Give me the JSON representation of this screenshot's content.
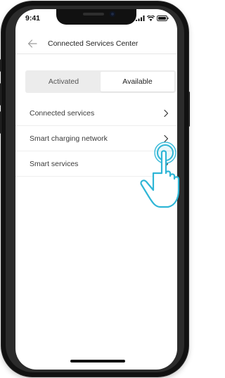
{
  "status_bar": {
    "time": "9:41"
  },
  "header": {
    "title": "Connected Services Center"
  },
  "tabs": [
    {
      "label": "Activated",
      "selected": false
    },
    {
      "label": "Available",
      "selected": true
    }
  ],
  "list": {
    "items": [
      {
        "label": "Connected services"
      },
      {
        "label": "Smart charging network"
      },
      {
        "label": "Smart services"
      }
    ]
  },
  "colors": {
    "accent_highlight": "#2fb6d6",
    "text_primary": "#222222",
    "segment_background": "#ececec"
  },
  "icons": {
    "back": "arrow-left-icon",
    "chevron": "chevron-right-icon",
    "pointer": "tap-hand-icon"
  }
}
